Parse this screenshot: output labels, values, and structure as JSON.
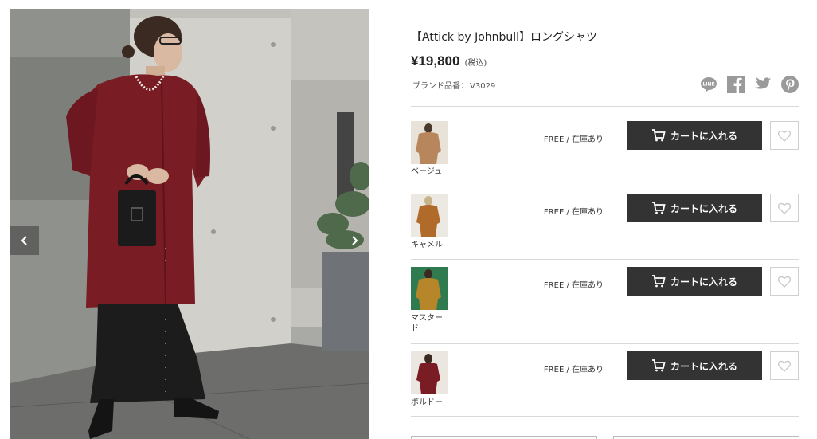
{
  "product": {
    "title": "【Attick by Johnbull】ロングシャツ",
    "price": "¥19,800",
    "tax_note": "(税込)",
    "brand_code_label": "ブランド品番：",
    "brand_code": "V3029"
  },
  "share": [
    "line-icon",
    "facebook-icon",
    "twitter-icon",
    "pinterest-icon"
  ],
  "variants": [
    {
      "color": "ベージュ",
      "stock": "FREE / 在庫あり",
      "cart_label": "カートに入れる",
      "swatch": "#b8865c"
    },
    {
      "color": "キャメル",
      "stock": "FREE / 在庫あり",
      "cart_label": "カートに入れる",
      "swatch": "#b06a2a"
    },
    {
      "color": "マスタード",
      "stock": "FREE / 在庫あり",
      "cart_label": "カートに入れる",
      "swatch": "#b8862a"
    },
    {
      "color": "ボルドー",
      "stock": "FREE / 在庫あり",
      "cart_label": "カートに入れる",
      "swatch": "#7a1c24"
    }
  ],
  "colors": {
    "button_bg": "#333333",
    "divider": "#d9d9d9"
  }
}
